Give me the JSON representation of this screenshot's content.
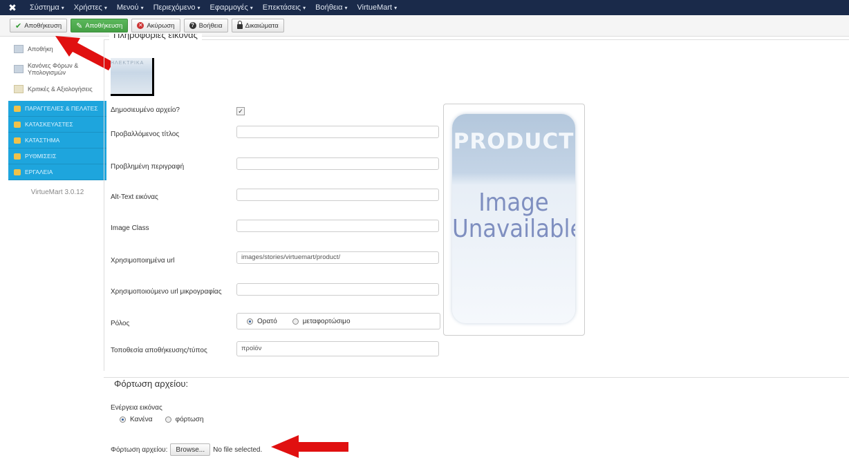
{
  "topbar": {
    "menus": [
      {
        "label": "Σύστημα",
        "caret": "▾"
      },
      {
        "label": "Χρήστες",
        "caret": "▾"
      },
      {
        "label": "Μενού",
        "caret": "▾"
      },
      {
        "label": "Περιεχόμενο",
        "caret": "▾"
      },
      {
        "label": "Εφαρμογές",
        "caret": "▾"
      },
      {
        "label": "Επεκτάσεις",
        "caret": "▾"
      },
      {
        "label": "Βοήθεια",
        "caret": "▾"
      },
      {
        "label": "VirtueMart",
        "caret": "▾"
      }
    ]
  },
  "toolbar": {
    "save": "Αποθήκευση",
    "save_edit": "Αποθήκευση",
    "cancel": "Ακύρωση",
    "help": "Βοήθεια",
    "permissions": "Δικαιώματα"
  },
  "sidebar": {
    "items": [
      "Αποθήκη",
      "Κανόνες Φόρων & Υπολογισμών",
      "Κριτικές & Αξιολογήσεις"
    ],
    "sections": [
      "ΠΑΡΑΓΓΕΛΙΕΣ & ΠΕΛΑΤΕΣ",
      "ΚΑΤΑΣΚΕΥΑΣΤΕΣ",
      "ΚΑΤΑΣΤΗΜΑ",
      "ΡΥΘΜΙΣΕΙΣ",
      "ΕΡΓΑΛΕΙΑ"
    ],
    "version": "VirtueMart 3.0.12"
  },
  "image_info": {
    "legend": "Πληροφορίες εικόνας",
    "thumb_text": "ΗΛΕΚΤΡΙΚΑ",
    "published_label": "Δημοσιευμένο αρχείο?",
    "published_mark": "✓",
    "title_label": "Προβαλλόμενος τίτλος",
    "title_value": "",
    "desc_label": "Προβλημένη περιγραφή",
    "desc_value": "",
    "alt_label": "Alt-Text εικόνας",
    "alt_value": "",
    "class_label": "Image Class",
    "class_value": "",
    "url_label": "Χρησιμοποιημένα url",
    "url_value": "images/stories/virtuemart/product/",
    "thumb_url_label": "Χρησιμοποιούμενο url μικρογραφίας",
    "thumb_url_value": "",
    "role_label": "Ρόλος",
    "role_visible": "Ορατό",
    "role_download": "μεταφορτώσιμο",
    "location_label": "Τοποθεσία αποθήκευσης/τύπος",
    "location_value": "προϊόν",
    "preview_top": "PRODUCT",
    "preview_line1": "Image",
    "preview_line2": "Unavailable"
  },
  "upload": {
    "legend": "Φόρτωση αρχείου:",
    "action_label": "Ενέργεια εικόνας",
    "option_none": "Κανένα",
    "option_upload": "φόρτωση",
    "file_label": "Φόρτωση αρχείου:",
    "browse": "Browse...",
    "no_file": "No file selected."
  },
  "colors": {
    "topbar": "#1a2a4a",
    "sidebar_blue": "#1ea5dd",
    "save_green": "#45a045",
    "arrow_red": "#e01010"
  }
}
